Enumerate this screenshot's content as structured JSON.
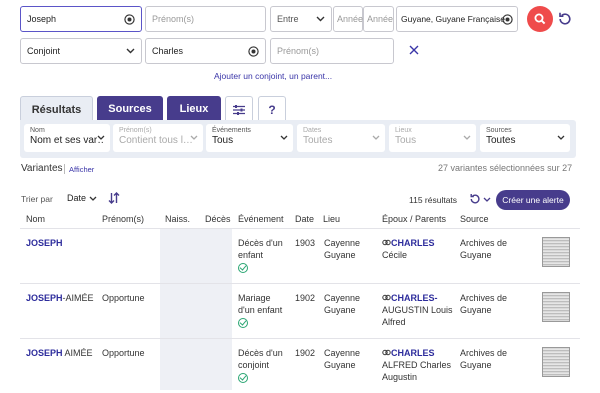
{
  "search": {
    "surname": "Joseph",
    "firstname_placeholder": "Prénom(s)",
    "period_label": "Entre",
    "year1_placeholder": "Année",
    "year2_placeholder": "Année",
    "place": "Guyane, Guyane Française",
    "relation": "Conjoint",
    "rel_name": "Charles",
    "rel_firstname_placeholder": "Prénom(s)",
    "add_link": "Ajouter un conjoint, un parent..."
  },
  "tabs": [
    "Résultats",
    "Sources",
    "Lieux",
    "sliders-icon",
    "?"
  ],
  "filters": [
    {
      "title": "Nom",
      "value": "Nom et ses var…",
      "enabled": true
    },
    {
      "title": "Prénom(s)",
      "value": "Contient tous l…",
      "enabled": false
    },
    {
      "title": "Événements",
      "value": "Tous",
      "enabled": true
    },
    {
      "title": "Dates",
      "value": "Toutes",
      "enabled": false
    },
    {
      "title": "Lieux",
      "value": "Tous",
      "enabled": false
    },
    {
      "title": "Sources",
      "value": "Toutes",
      "enabled": true
    }
  ],
  "variants": {
    "label": "Variantes",
    "show": "Afficher",
    "summary": "27 variantes sélectionnées sur 27"
  },
  "toolbar": {
    "sort_label": "Trier par",
    "sort_value": "Date",
    "count": "115 résultats",
    "alert_button": "Créer une alerte"
  },
  "columns": [
    "Nom",
    "Prénom(s)",
    "Naiss.",
    "Décès",
    "Événement",
    "Date",
    "Lieu",
    "Époux / Parents",
    "Source"
  ],
  "rows": [
    {
      "name_bold": "JOSEPH",
      "name_rest": "",
      "prenoms": "",
      "event": [
        "Décès d'un",
        "enfant"
      ],
      "date": "1903",
      "place": [
        "Cayenne",
        "Guyane"
      ],
      "spouse_bold": "CHARLES",
      "spouse_rest": [
        "Cécile"
      ],
      "source": [
        "Archives de",
        "Guyane"
      ]
    },
    {
      "name_bold": "JOSEPH",
      "name_rest": "-AIMÉE",
      "prenoms": "Opportune",
      "event": [
        "Mariage",
        "d'un enfant"
      ],
      "date": "1902",
      "place": [
        "Cayenne",
        "Guyane"
      ],
      "spouse_bold": "CHARLES-",
      "spouse_rest": [
        "AUGUSTIN Louis",
        "Alfred"
      ],
      "source": [
        "Archives de",
        "Guyane"
      ]
    },
    {
      "name_bold": "JOSEPH",
      "name_rest": " AIMÉE",
      "prenoms": "Opportune",
      "event": [
        "Décès d'un",
        "conjoint"
      ],
      "date": "1902",
      "place": [
        "Cayenne",
        "Guyane"
      ],
      "spouse_bold": "CHARLES",
      "spouse_rest": [
        "ALFRED Charles",
        "Augustin"
      ],
      "source": [
        "Archives de",
        "Guyane"
      ]
    }
  ],
  "colors": {
    "accent": "#473c8c",
    "search_button": "#ef4b4b",
    "link": "#3a35a8",
    "check": "#2aa673"
  }
}
